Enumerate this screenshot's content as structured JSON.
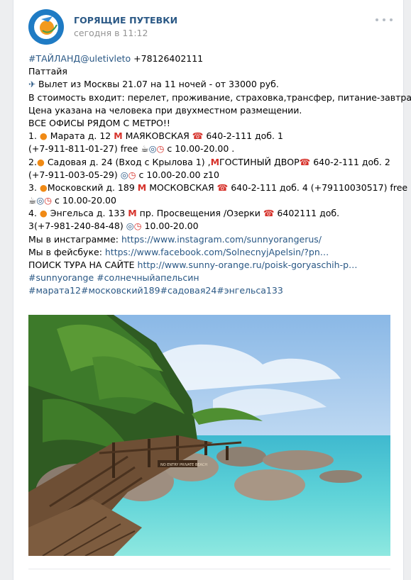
{
  "post": {
    "group_name": "ГОРЯЩИЕ ПУТЕВКИ",
    "time": "сегодня в 11:12",
    "lines": {
      "l1_tag": "#ТАЙЛАНД@uletivleto",
      "l1_phone": " +78126402111",
      "l2": "Паттайя",
      "l3_plane": "✈",
      "l3": " Вылет из Москвы 21.07 на 11 ночей - от 33000 руб.",
      "l4": "В стоимость входит: перелет, проживание, страховка,трансфер, питание-завтраки",
      "l5": "Цена указана на человека при двухместном размещении.",
      "l6": "ВСЕ ОФИСЫ РЯДОМ С МЕТРО!!",
      "l7_a": "1. ",
      "l7_b": " Марата д. 12 ",
      "l7_c": " МАЯКОВСКАЯ ",
      "l7_d": " 640-2-111 доб. 1",
      "l8_a": "(+7-911-811-01-27) free ",
      "l8_b": " с 10.00-20.00 .",
      "l9_a": "2.",
      "l9_b": " Садовая д. 24 (Вход с Крылова 1) ,",
      "l9_c": "ГОСТИНЫЙ ДВОР",
      "l9_d": " 640-2-111 доб. 2",
      "l10_a": "(+7-911-003-05-29) ",
      "l10_b": " с 10.00-20.00 z10",
      "l11_a": "3. ",
      "l11_b": "Московский д. 189 ",
      "l11_c": " МОСКОВСКАЯ ",
      "l11_d": " 640-2-111 доб. 4 (+79110030517) free",
      "l12": " с 10.00-20.00",
      "l13_a": "4. ",
      "l13_b": " Энгельса д. 133 ",
      "l13_c": " пр. Просвещения /Озерки ",
      "l13_d": " 6402111 доб.",
      "l14_a": "3(+7-981-240-84-48) ",
      "l14_b": " 10.00-20.00",
      "l15_a": "Мы в инстаграмме: ",
      "l15_link": "https://www.instagram.com/sunnyorangerus/",
      "l16_a": "Мы в фейсбуке: ",
      "l16_link": "https://www.facebook.com/SolnecnyjApelsin/?pn…",
      "l17_a": "ПОИСК ТУРА НА САЙТЕ ",
      "l17_link": "http://www.sunny-orange.ru/poisk-goryaschih-p…",
      "l18": "#sunnyorange #солнечныйапельсин",
      "l19": "#марата12#московский189#садовая24#энгельса133"
    },
    "icons": {
      "orange": "●",
      "metro": "M",
      "phone": "☎",
      "coffee": "☕",
      "wifi": "◎",
      "clock": "◷"
    },
    "photo": {
      "sign_text": "NO ENTRY PRIVATE BEACH"
    },
    "colors": {
      "link": "#2a5885",
      "accent_red": "#d6312a",
      "orange": "#f08a15"
    }
  }
}
